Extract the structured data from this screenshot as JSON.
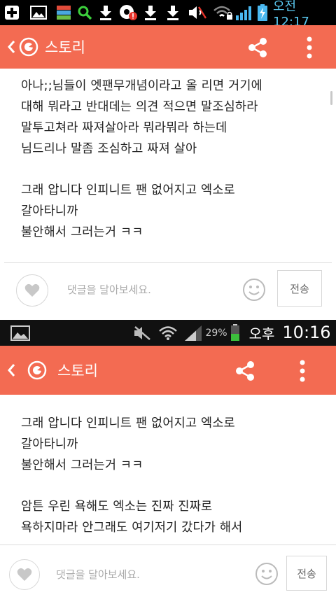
{
  "status_top": {
    "time": "오전 12:17",
    "icons": [
      "add-icon",
      "image-icon",
      "app-grid-icon",
      "search-icon",
      "download-icon",
      "record-alert-icon",
      "download-icon",
      "download-icon",
      "mute-icon",
      "wifi-lock-icon",
      "signal-icon",
      "battery-charging-icon"
    ]
  },
  "appbar_top": {
    "title": "스토리"
  },
  "post_top": {
    "paragraph1": [
      "아나;;님들이  엣팬무개념이라고 올 리면 거기에",
      "대해 뭐라고 반대데는 의견 적으면 말조심하라",
      "말투고쳐라 짜져살아라 뭐라뭐라 하는데",
      "님드리나 말좀 조심하고 짜져 살아"
    ],
    "paragraph2": [
      "그래 압니다  인피니트 팬 없어지고 엑소로",
      "갈아타니까",
      "불안해서 그러는거 ㅋㅋ"
    ]
  },
  "comment_top": {
    "placeholder": "댓글을 달아보세요.",
    "send_label": "전송"
  },
  "status_mid": {
    "battery_pct": "29%",
    "ampm": "오후",
    "time": "10:16"
  },
  "appbar_mid": {
    "title": "스토리"
  },
  "post_mid": {
    "paragraph1": [
      "그래 압니다  인피니트 팬 없어지고 엑소로",
      "갈아타니까",
      "불안해서 그러는거 ㅋㅋ"
    ],
    "paragraph2": [
      "암튼 우린 욕해도 엑소는 진짜 진짜로",
      "욕하지마라 안그래도 여기저기 갔다가 해서"
    ]
  },
  "comment_bottom": {
    "placeholder": "댓글을 달아보세요.",
    "send_label": "전송"
  },
  "colors": {
    "accent": "#f36b52",
    "status_time": "#5ac8f0"
  }
}
